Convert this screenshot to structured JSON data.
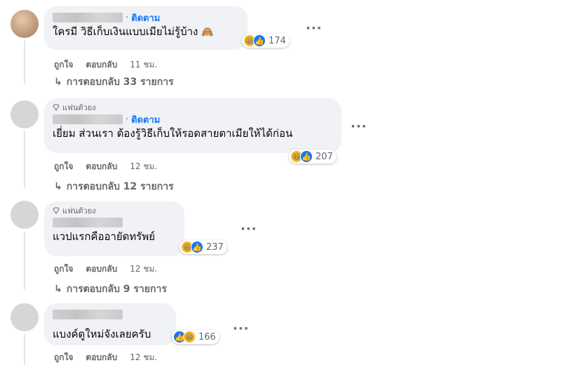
{
  "comments": [
    {
      "follow": "ติดตาม",
      "text": "ใครมี วิธีเก็บเงินแบบเมียไม่รู้บ้าง",
      "emoji": "🙈",
      "reaction_count": "174",
      "like_label": "ถูกใจ",
      "reply_label": "ตอบกลับ",
      "time": "11 ชม.",
      "replies": "การตอบกลับ 33 รายการ"
    },
    {
      "badge": "แฟนตัวยง",
      "follow": "ติดตาม",
      "text": "เยี่ยม ส่วนเรา ต้องรู้วิธีเก็บให้รอดสายตาเมียให้ได้ก่อน",
      "reaction_count": "207",
      "like_label": "ถูกใจ",
      "reply_label": "ตอบกลับ",
      "time": "12 ชม.",
      "replies": "การตอบกลับ 12 รายการ"
    },
    {
      "badge": "แฟนตัวยง",
      "text": "แวปแรกคืออายัดทรัพย์",
      "reaction_count": "237",
      "like_label": "ถูกใจ",
      "reply_label": "ตอบกลับ",
      "time": "12 ชม.",
      "replies": "การตอบกลับ 9 รายการ"
    },
    {
      "text": "แบงค์ดูใหม่จังเลยครับ",
      "reaction_count": "166",
      "like_label": "ถูกใจ",
      "reply_label": "ตอบกลับ",
      "time": "12 ชม."
    }
  ],
  "icons": {
    "haha": "haha-reaction-icon",
    "like": "like-reaction-icon",
    "gem": "gem-icon",
    "more": "more-options-icon",
    "reply_arrow": "reply-arrow-icon"
  },
  "colors": {
    "follow": "#1877f2",
    "bubble": "#f0f2f5",
    "haha": "#f7b928",
    "like": "#1877f2"
  }
}
